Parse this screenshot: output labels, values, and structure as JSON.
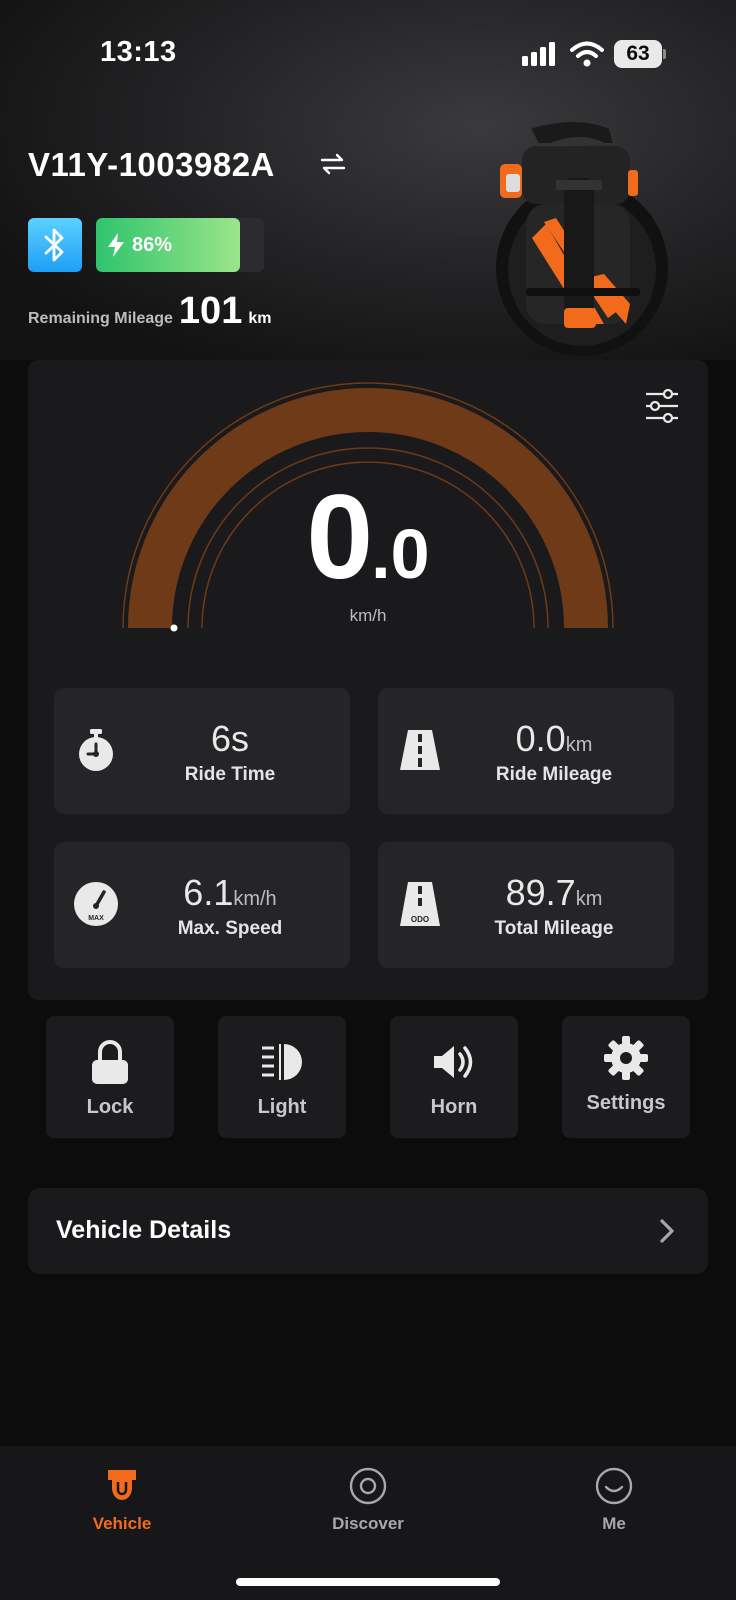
{
  "status_bar": {
    "time": "13:13",
    "battery_level": "63"
  },
  "vehicle": {
    "id": "V11Y-1003982A",
    "battery_percent_label": "86%",
    "battery_fraction": 0.86,
    "remaining_mileage_label": "Remaining Mileage",
    "remaining_mileage_value": "101",
    "remaining_mileage_unit": "km"
  },
  "speedometer": {
    "speed_int": "0",
    "speed_dec": ".0",
    "unit": "km/h",
    "level": 0.0
  },
  "stats": {
    "ride_time": {
      "value": "6s",
      "label": "Ride Time"
    },
    "ride_mileage": {
      "value": "0.0",
      "unit": "km",
      "label": "Ride Mileage"
    },
    "max_speed": {
      "value": "6.1",
      "unit": "km/h",
      "label": "Max. Speed",
      "icon_text": "MAX"
    },
    "total_mileage": {
      "value": "89.7",
      "unit": "km",
      "label": "Total Mileage",
      "icon_text": "ODO"
    }
  },
  "actions": {
    "lock": "Lock",
    "light": "Light",
    "horn": "Horn",
    "settings": "Settings"
  },
  "vehicle_details_label": "Vehicle Details",
  "tabs": {
    "vehicle": "Vehicle",
    "discover": "Discover",
    "me": "Me"
  },
  "colors": {
    "accent": "#f26a1b",
    "gauge_arc": "#6e3a17",
    "battery_green": "#2fc46d",
    "bluetooth_blue": "#1f9ef5"
  }
}
